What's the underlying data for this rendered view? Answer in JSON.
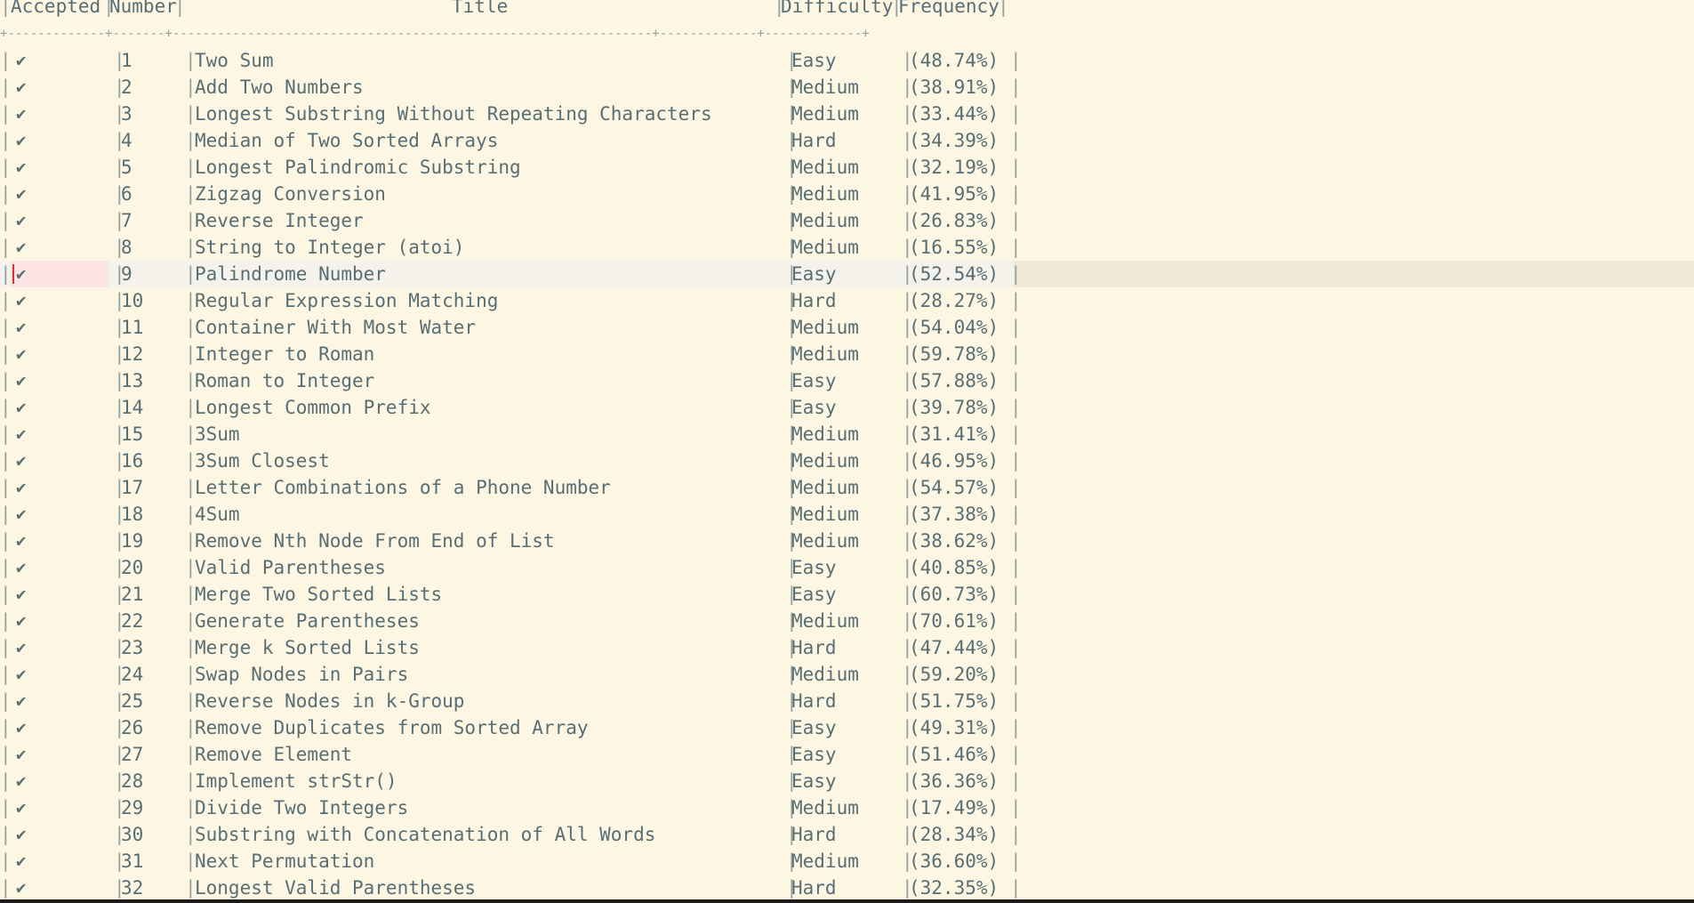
{
  "table": {
    "headers": {
      "accepted": "Accepted",
      "number": "Number",
      "title": "Title",
      "difficulty": "Difficulty",
      "frequency": "Frequency"
    },
    "check_glyph": "✔",
    "current_row": 9,
    "rows": [
      {
        "number": "1",
        "title": "Two Sum",
        "difficulty": "Easy",
        "frequency": "(48.74%)"
      },
      {
        "number": "2",
        "title": "Add Two Numbers",
        "difficulty": "Medium",
        "frequency": "(38.91%)"
      },
      {
        "number": "3",
        "title": "Longest Substring Without Repeating Characters",
        "difficulty": "Medium",
        "frequency": "(33.44%)"
      },
      {
        "number": "4",
        "title": "Median of Two Sorted Arrays",
        "difficulty": "Hard",
        "frequency": "(34.39%)"
      },
      {
        "number": "5",
        "title": "Longest Palindromic Substring",
        "difficulty": "Medium",
        "frequency": "(32.19%)"
      },
      {
        "number": "6",
        "title": "Zigzag Conversion",
        "difficulty": "Medium",
        "frequency": "(41.95%)"
      },
      {
        "number": "7",
        "title": "Reverse Integer",
        "difficulty": "Medium",
        "frequency": "(26.83%)"
      },
      {
        "number": "8",
        "title": "String to Integer (atoi)",
        "difficulty": "Medium",
        "frequency": "(16.55%)"
      },
      {
        "number": "9",
        "title": "Palindrome Number",
        "difficulty": "Easy",
        "frequency": "(52.54%)"
      },
      {
        "number": "10",
        "title": "Regular Expression Matching",
        "difficulty": "Hard",
        "frequency": "(28.27%)"
      },
      {
        "number": "11",
        "title": "Container With Most Water",
        "difficulty": "Medium",
        "frequency": "(54.04%)"
      },
      {
        "number": "12",
        "title": "Integer to Roman",
        "difficulty": "Medium",
        "frequency": "(59.78%)"
      },
      {
        "number": "13",
        "title": "Roman to Integer",
        "difficulty": "Easy",
        "frequency": "(57.88%)"
      },
      {
        "number": "14",
        "title": "Longest Common Prefix",
        "difficulty": "Easy",
        "frequency": "(39.78%)"
      },
      {
        "number": "15",
        "title": "3Sum",
        "difficulty": "Medium",
        "frequency": "(31.41%)"
      },
      {
        "number": "16",
        "title": "3Sum Closest",
        "difficulty": "Medium",
        "frequency": "(46.95%)"
      },
      {
        "number": "17",
        "title": "Letter Combinations of a Phone Number",
        "difficulty": "Medium",
        "frequency": "(54.57%)"
      },
      {
        "number": "18",
        "title": "4Sum",
        "difficulty": "Medium",
        "frequency": "(37.38%)"
      },
      {
        "number": "19",
        "title": "Remove Nth Node From End of List",
        "difficulty": "Medium",
        "frequency": "(38.62%)"
      },
      {
        "number": "20",
        "title": "Valid Parentheses",
        "difficulty": "Easy",
        "frequency": "(40.85%)"
      },
      {
        "number": "21",
        "title": "Merge Two Sorted Lists",
        "difficulty": "Easy",
        "frequency": "(60.73%)"
      },
      {
        "number": "22",
        "title": "Generate Parentheses",
        "difficulty": "Medium",
        "frequency": "(70.61%)"
      },
      {
        "number": "23",
        "title": "Merge k Sorted Lists",
        "difficulty": "Hard",
        "frequency": "(47.44%)"
      },
      {
        "number": "24",
        "title": "Swap Nodes in Pairs",
        "difficulty": "Medium",
        "frequency": "(59.20%)"
      },
      {
        "number": "25",
        "title": "Reverse Nodes in k-Group",
        "difficulty": "Hard",
        "frequency": "(51.75%)"
      },
      {
        "number": "26",
        "title": "Remove Duplicates from Sorted Array",
        "difficulty": "Easy",
        "frequency": "(49.31%)"
      },
      {
        "number": "27",
        "title": "Remove Element",
        "difficulty": "Easy",
        "frequency": "(51.46%)"
      },
      {
        "number": "28",
        "title": "Implement strStr()",
        "difficulty": "Easy",
        "frequency": "(36.36%)"
      },
      {
        "number": "29",
        "title": "Divide Two Integers",
        "difficulty": "Medium",
        "frequency": "(17.49%)"
      },
      {
        "number": "30",
        "title": "Substring with Concatenation of All Words",
        "difficulty": "Hard",
        "frequency": "(28.34%)"
      },
      {
        "number": "31",
        "title": "Next Permutation",
        "difficulty": "Medium",
        "frequency": "(36.60%)"
      },
      {
        "number": "32",
        "title": "Longest Valid Parentheses",
        "difficulty": "Hard",
        "frequency": "(32.35%)"
      }
    ]
  },
  "colors": {
    "background": "#fdf6e3",
    "text": "#586e75",
    "separator": "#93a1a1",
    "current_line": "#eee8d5",
    "cursor": "#dc322f"
  }
}
